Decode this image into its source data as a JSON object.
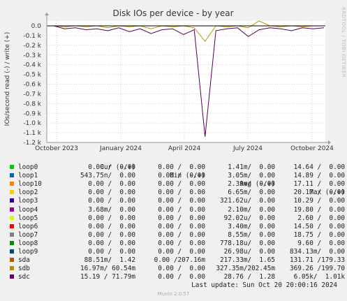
{
  "chart_data": {
    "type": "line",
    "title": "Disk IOs per device - by year",
    "ylabel": "IOs/second read (-) / write (+)",
    "side_label": "RRDTOOL / TOBI OETIKER",
    "x_ticks": [
      "October 2023",
      "January 2024",
      "April 2024",
      "July 2024",
      "October 2024"
    ],
    "x_range": [
      "2023-09-17",
      "2024-10-20"
    ],
    "ylim": [
      -1.2,
      0.05
    ],
    "y_ticks": [
      "0.0",
      "-0.1 k",
      "-0.2 k",
      "-0.3 k",
      "-0.4 k",
      "-0.5 k",
      "-0.6 k",
      "-0.7 k",
      "-0.8 k",
      "-0.9 k",
      "-1.0 k",
      "-1.1 k",
      "-1.2 k"
    ],
    "y_tick_values": [
      0,
      -0.1,
      -0.2,
      -0.3,
      -0.4,
      -0.5,
      -0.6,
      -0.7,
      -0.8,
      -0.9,
      -1.0,
      -1.1,
      -1.2
    ],
    "grid": true,
    "series": [
      {
        "name": "sdc",
        "color": "#54004d",
        "values": [
          0,
          -0.03,
          -0.02,
          -0.04,
          -0.03,
          -0.05,
          -0.02,
          -0.06,
          -0.03,
          -0.08,
          -0.04,
          -0.03,
          -0.09,
          -0.04,
          -1.14,
          -0.05,
          -0.03,
          -0.02,
          -0.11,
          -0.04,
          -0.02,
          -0.03,
          -0.05,
          -0.02,
          -0.03,
          -0.02
        ]
      },
      {
        "name": "sdb",
        "color": "#b89700",
        "values": [
          0,
          -0.01,
          0,
          -0.01,
          0,
          -0.02,
          0,
          -0.01,
          0,
          -0.03,
          0,
          -0.01,
          0,
          -0.02,
          -0.16,
          0,
          -0.01,
          0,
          -0.02,
          0.05,
          0,
          -0.01,
          0,
          -0.01,
          0,
          0
        ]
      }
    ]
  },
  "legend": {
    "headers": {
      "cur": "Cur (-/+)",
      "min": "Min (-/+)",
      "avg": "Avg (-/+)",
      "max": "Max (-/+)"
    },
    "rows": [
      {
        "name": "loop0",
        "color": "#00cc00",
        "cur": "0.00 /  0.00",
        "min": "0.00 /  0.00",
        "avg": "1.41m/  0.00",
        "max": "14.64 /  0.00"
      },
      {
        "name": "loop1",
        "color": "#0066b3",
        "cur": "543.75n/  0.00",
        "min": "0.00 /  0.00",
        "avg": "3.05m/  0.00",
        "max": "14.89 /  0.00"
      },
      {
        "name": "loop10",
        "color": "#ff8000",
        "cur": "0.00 /  0.00",
        "min": "0.00 /  0.00",
        "avg": "2.39m/  0.00",
        "max": "17.11 /  0.00"
      },
      {
        "name": "loop2",
        "color": "#ffcc00",
        "cur": "0.00 /  0.00",
        "min": "0.00 /  0.00",
        "avg": "6.65m/  0.00",
        "max": "20.17 /  0.00"
      },
      {
        "name": "loop3",
        "color": "#330099",
        "cur": "0.00 /  0.00",
        "min": "0.00 /  0.00",
        "avg": "321.62u/  0.00",
        "max": "10.29 /  0.00"
      },
      {
        "name": "loop4",
        "color": "#990099",
        "cur": "3.68m/  0.00",
        "min": "0.00 /  0.00",
        "avg": "2.10m/  0.00",
        "max": "19.80 /  0.00"
      },
      {
        "name": "loop5",
        "color": "#ccff00",
        "cur": "0.00 /  0.00",
        "min": "0.00 /  0.00",
        "avg": "92.02u/  0.00",
        "max": "2.60 /  0.00"
      },
      {
        "name": "loop6",
        "color": "#ff0000",
        "cur": "0.00 /  0.00",
        "min": "0.00 /  0.00",
        "avg": "3.40m/  0.00",
        "max": "14.50 /  0.00"
      },
      {
        "name": "loop7",
        "color": "#808080",
        "cur": "0.00 /  0.00",
        "min": "0.00 /  0.00",
        "avg": "8.55m/  0.00",
        "max": "18.75 /  0.00"
      },
      {
        "name": "loop8",
        "color": "#008f00",
        "cur": "0.00 /  0.00",
        "min": "0.00 /  0.00",
        "avg": "778.18u/  0.00",
        "max": "9.60 /  0.00"
      },
      {
        "name": "loop9",
        "color": "#00487d",
        "cur": "0.00 /  0.00",
        "min": "0.00 /  0.00",
        "avg": "26.98u/  0.00",
        "max": "834.13m/  0.00"
      },
      {
        "name": "sda",
        "color": "#b35a00",
        "cur": "88.51m/  1.42",
        "min": "0.00 /207.16m",
        "avg": "217.33m/  1.65",
        "max": "131.71 /179.33"
      },
      {
        "name": "sdb",
        "color": "#b38f00",
        "cur": "16.97m/ 60.54m",
        "min": "0.00 /  0.00",
        "avg": "327.35m/202.45m",
        "max": "369.26 /199.70"
      },
      {
        "name": "sdc",
        "color": "#6b006b",
        "cur": "15.19 / 71.79m",
        "min": "0.00 /  0.00",
        "avg": "28.76 /  1.28",
        "max": "6.05k/  1.01k"
      }
    ]
  },
  "footer": {
    "last_update": "Last update: Sun Oct 20 20:00:16 2024",
    "version": "Munin 2.0.57"
  }
}
